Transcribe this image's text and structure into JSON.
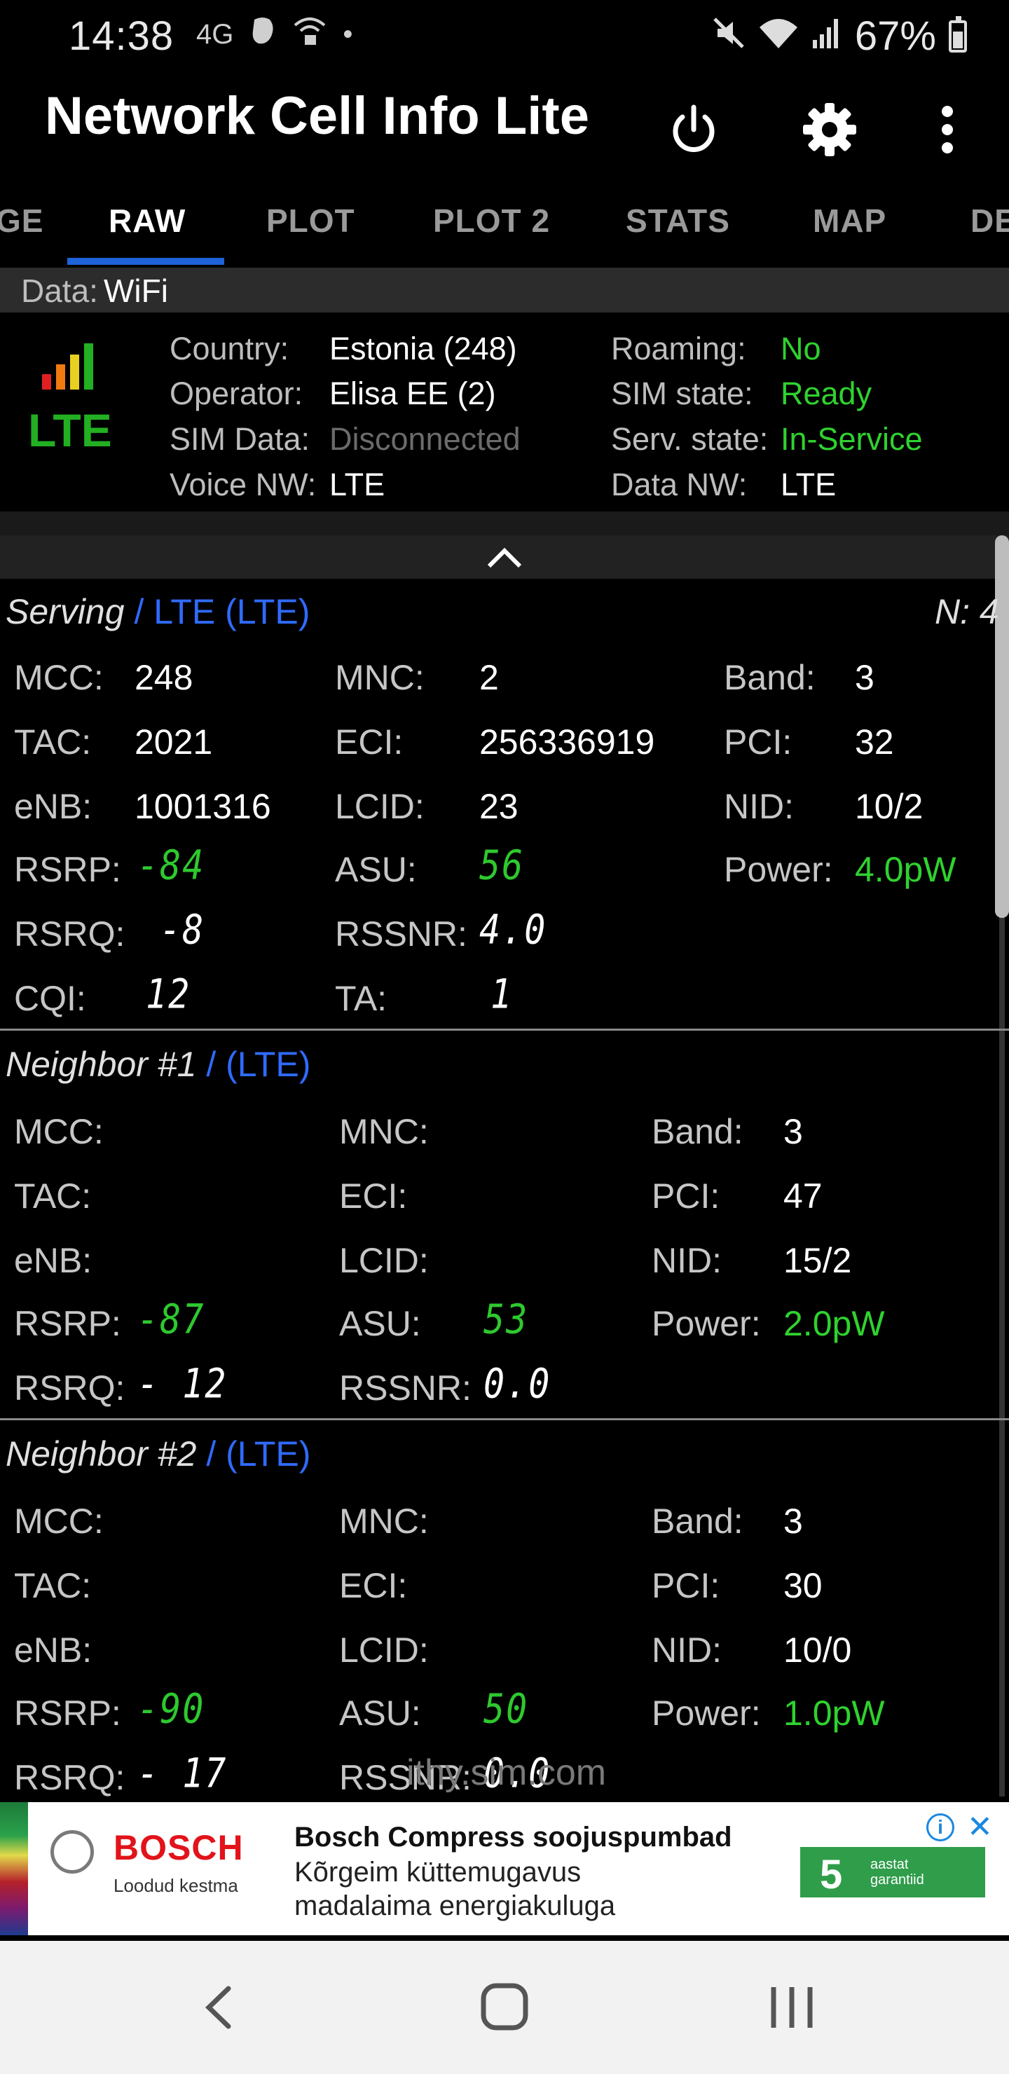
{
  "status_bar": {
    "time": "14:38",
    "network_type": "4G",
    "battery": "67%"
  },
  "app_bar": {
    "title": "Network Cell Info Lite",
    "power_icon": "power-icon",
    "settings_icon": "gear-icon",
    "more_icon": "more-vert-icon"
  },
  "tabs": [
    {
      "label": "GE"
    },
    {
      "label": "RAW"
    },
    {
      "label": "PLOT"
    },
    {
      "label": "PLOT 2"
    },
    {
      "label": "STATS"
    },
    {
      "label": "MAP"
    },
    {
      "label": "DE"
    }
  ],
  "data_bar": {
    "label": "Data:",
    "value": "WiFi"
  },
  "network_info": {
    "tech": "LTE",
    "country": {
      "label": "Country:",
      "value": "Estonia (248)"
    },
    "operator": {
      "label": "Operator:",
      "value": "Elisa EE (2)"
    },
    "sim_data": {
      "label": "SIM Data:",
      "value": "Disconnected"
    },
    "voice_nw": {
      "label": "Voice NW:",
      "value": "LTE"
    },
    "roaming": {
      "label": "Roaming:",
      "value": "No"
    },
    "sim_state": {
      "label": "SIM state:",
      "value": "Ready"
    },
    "serv_state": {
      "label": "Serv. state:",
      "value": "In-Service"
    },
    "data_nw": {
      "label": "Data NW:",
      "value": "LTE"
    }
  },
  "serving": {
    "title": "Serving",
    "tech": "/ LTE (LTE)",
    "count": "N: 4",
    "mcc": "248",
    "mnc": "2",
    "band": "3",
    "tac": "2021",
    "eci": "256336919",
    "pci": "32",
    "enb": "1001316",
    "lcid": "23",
    "nid": "10/2",
    "rsrp": "-84",
    "asu": "56",
    "power": "4.0pW",
    "rsrq": "-8",
    "rssnr": "4.0",
    "cqi": "12",
    "ta": "1"
  },
  "neighbor1": {
    "title": "Neighbor #1",
    "tech": "/ (LTE)",
    "band": "3",
    "pci": "47",
    "nid": "15/2",
    "rsrp": "-87",
    "asu": "53",
    "power": "2.0pW",
    "rsrq": "- 12",
    "rssnr": "0.0"
  },
  "neighbor2": {
    "title": "Neighbor #2",
    "tech": "/ (LTE)",
    "band": "3",
    "pci": "30",
    "nid": "10/0",
    "rsrp": "-90",
    "asu": "50",
    "power": "1.0pW",
    "rsrq": "- 17",
    "rssnr": "0.0"
  },
  "labels": {
    "mcc": "MCC:",
    "mnc": "MNC:",
    "band": "Band:",
    "tac": "TAC:",
    "eci": "ECI:",
    "pci": "PCI:",
    "enb": "eNB:",
    "lcid": "LCID:",
    "nid": "NID:",
    "rsrp": "RSRP:",
    "asu": "ASU:",
    "power": "Power:",
    "rsrq": "RSRQ:",
    "rssnr": "RSSNR:",
    "cqi": "CQI:",
    "ta": "TA:"
  },
  "watermark": "ithy.sim.com",
  "ad": {
    "brand": "BOSCH",
    "tagline": "Loodud kestma",
    "headline": "Bosch Compress soojuspumbad",
    "line1": "Kõrgeim küttemugavus",
    "line2": "madalaima energiakuluga",
    "badge_number": "5",
    "badge_text1": "aastat",
    "badge_text2": "garantiid"
  },
  "colors": {
    "accent": "#1e63d9",
    "good": "#2fd22f",
    "link_blue": "#2f6bff"
  }
}
